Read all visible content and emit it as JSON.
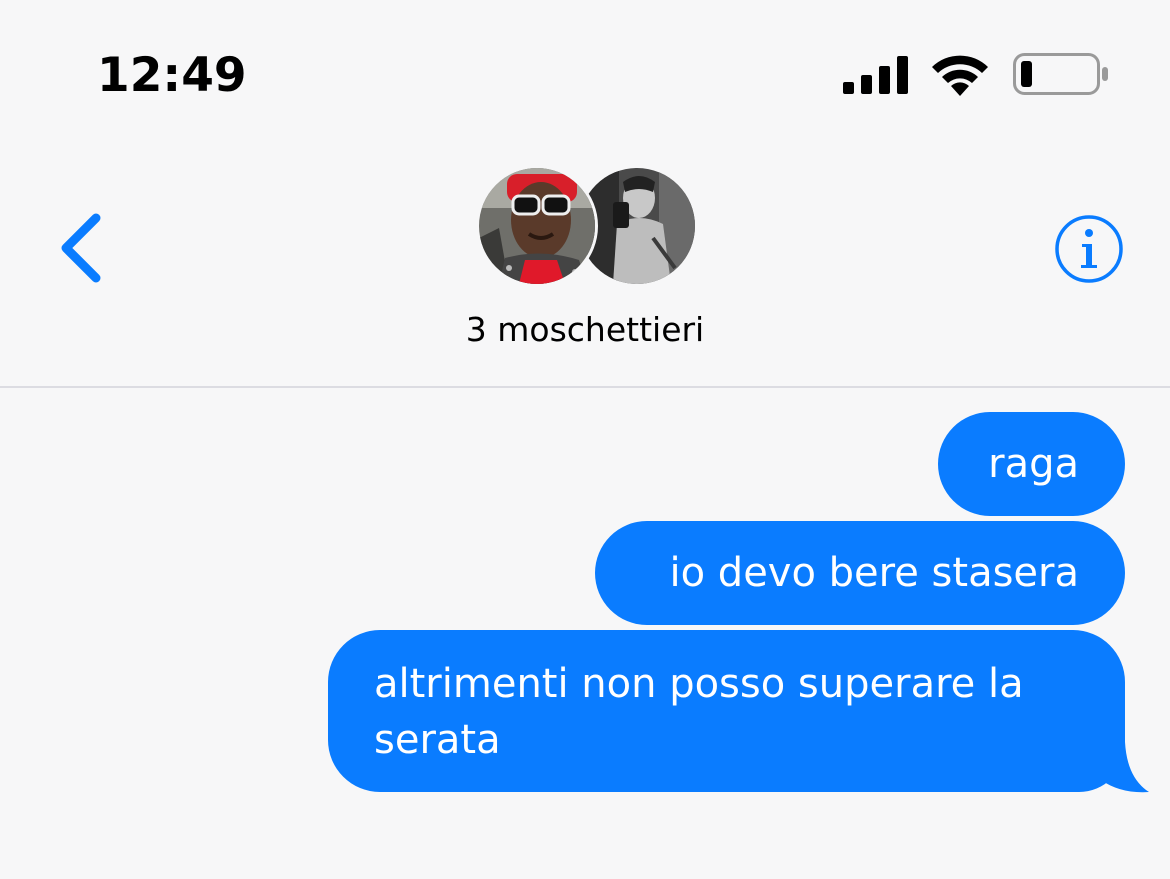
{
  "status_bar": {
    "time": "12:49",
    "icons": [
      "signal-icon",
      "wifi-icon",
      "battery-icon"
    ],
    "battery_level": 0.15
  },
  "header": {
    "back_icon": "chevron-left-icon",
    "info_icon": "info-icon",
    "group_name": "3 moschettieri",
    "avatars": [
      "avatar-sunglasses",
      "avatar-mirror-selfie"
    ]
  },
  "messages": [
    {
      "text": "raga",
      "sent": true
    },
    {
      "text": "io devo bere stasera",
      "sent": true
    },
    {
      "text": "altrimenti non posso superare la serata",
      "sent": true
    }
  ],
  "colors": {
    "accent": "#0a7cff",
    "background": "#f7f7f8",
    "bubble_text": "#ffffff",
    "divider": "#dcdce2"
  }
}
